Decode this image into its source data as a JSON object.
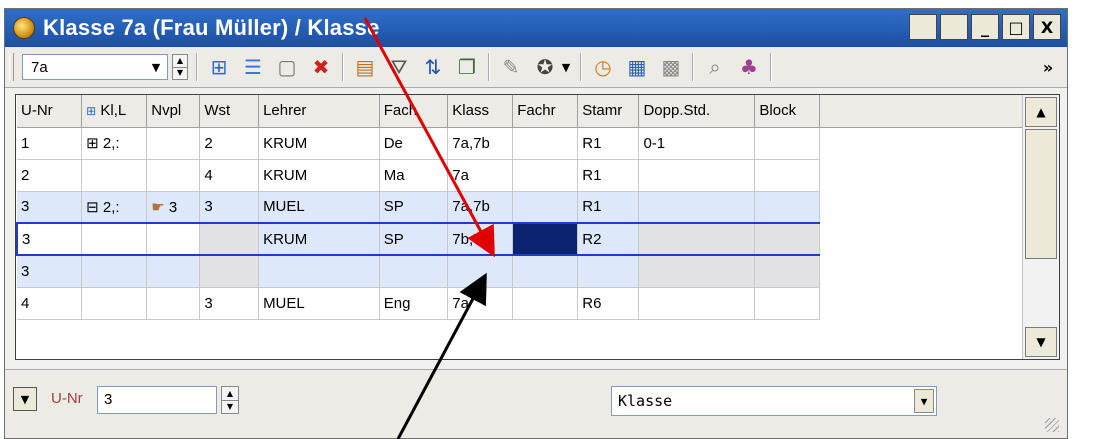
{
  "window": {
    "title": "Klasse 7a (Frau Müller) / Klasse",
    "buttons": [
      "",
      "",
      "_",
      "□",
      "X"
    ]
  },
  "toolbar": {
    "class_selector_value": "7a",
    "icons": [
      "insert-row-icon",
      "list-icon",
      "new-icon",
      "delete-icon",
      "report-icon",
      "filter-icon",
      "sort-icon",
      "clipboard-icon",
      "tools-icon",
      "graduation-icon",
      "clock-icon",
      "calendar-icon",
      "grid-icon",
      "zoom-icon",
      "users-icon"
    ],
    "overflow": "»"
  },
  "table": {
    "columns": [
      "U-Nr",
      "Kl,L",
      "Nvpl",
      "Wst",
      "Lehrer",
      "Fach",
      "Klass",
      "Fachr",
      "Stamr",
      "Dopp.Std.",
      "Block"
    ],
    "rows": [
      [
        "1",
        "⊞ 2,:",
        "",
        "2",
        "KRUM",
        "De",
        "7a,7b",
        "",
        "R1",
        "0-1",
        ""
      ],
      [
        "2",
        "",
        "",
        "4",
        "KRUM",
        "Ma",
        "7a",
        "",
        "R1",
        "",
        ""
      ],
      [
        "3",
        "⊟ 2,:",
        "3",
        "3",
        "MUEL",
        "SP",
        "7a,7b",
        "",
        "R1",
        "",
        ""
      ],
      [
        "3",
        "",
        "",
        "",
        "KRUM",
        "SP",
        "7b,7a",
        "",
        "R2",
        "",
        ""
      ],
      [
        "3",
        "",
        "",
        "",
        "",
        "",
        "",
        "",
        "",
        "",
        ""
      ],
      [
        "4",
        "",
        "",
        "3",
        "MUEL",
        "Eng",
        "7a",
        "",
        "R6",
        "",
        ""
      ]
    ]
  },
  "statusbar": {
    "field_label": "U-Nr",
    "field_value": "3",
    "view_selector": "Klasse"
  },
  "colors": {
    "title_bar": "#2f6fc8",
    "selected_row": "#dde8fb",
    "current_row_border": "#1c3fc0",
    "annotation_red": "#e00000",
    "annotation_black": "#000000"
  }
}
